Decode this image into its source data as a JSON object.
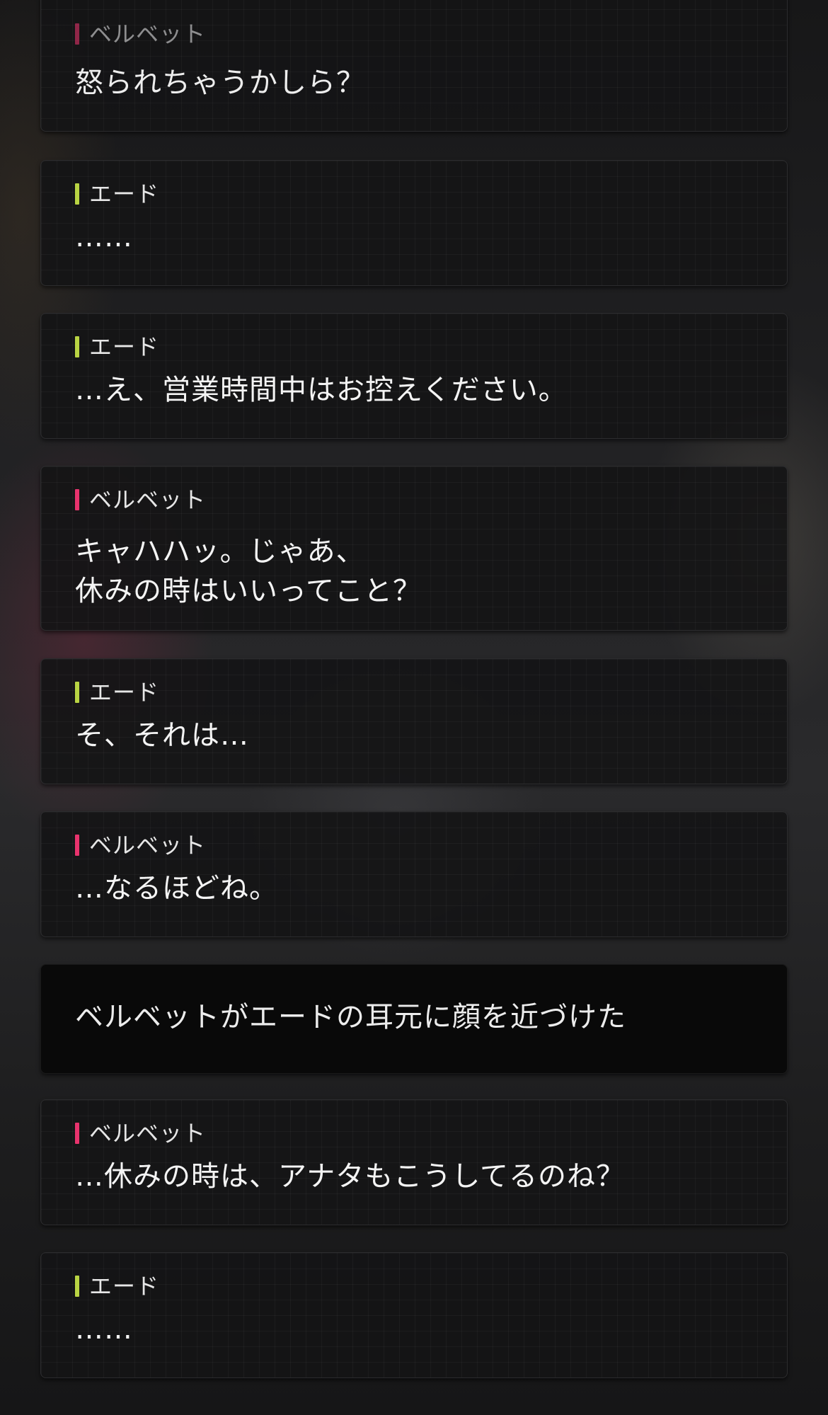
{
  "colors": {
    "velvet_accent": "#e8336d",
    "ade_accent": "#b9d443",
    "card_bg": "#141415",
    "text": "#f4f4f4"
  },
  "log": [
    {
      "speaker": "ベルベット",
      "text": "怒られちゃうかしら？"
    },
    {
      "speaker": "エード",
      "text": "……"
    },
    {
      "speaker": "エード",
      "text": "…え、営業時間中はお控えください。"
    },
    {
      "speaker": "ベルベット",
      "text": "キャハハッ。じゃあ、\n休みの時はいいってこと？"
    },
    {
      "speaker": "エード",
      "text": "そ、それは…"
    },
    {
      "speaker": "ベルベット",
      "text": "…なるほどね。"
    },
    {
      "speaker": "",
      "text": "ベルベットがエードの耳元に顔を近づけた"
    },
    {
      "speaker": "ベルベット",
      "text": "…休みの時は、アナタもこうしてるのね？"
    },
    {
      "speaker": "エード",
      "text": "……"
    }
  ]
}
